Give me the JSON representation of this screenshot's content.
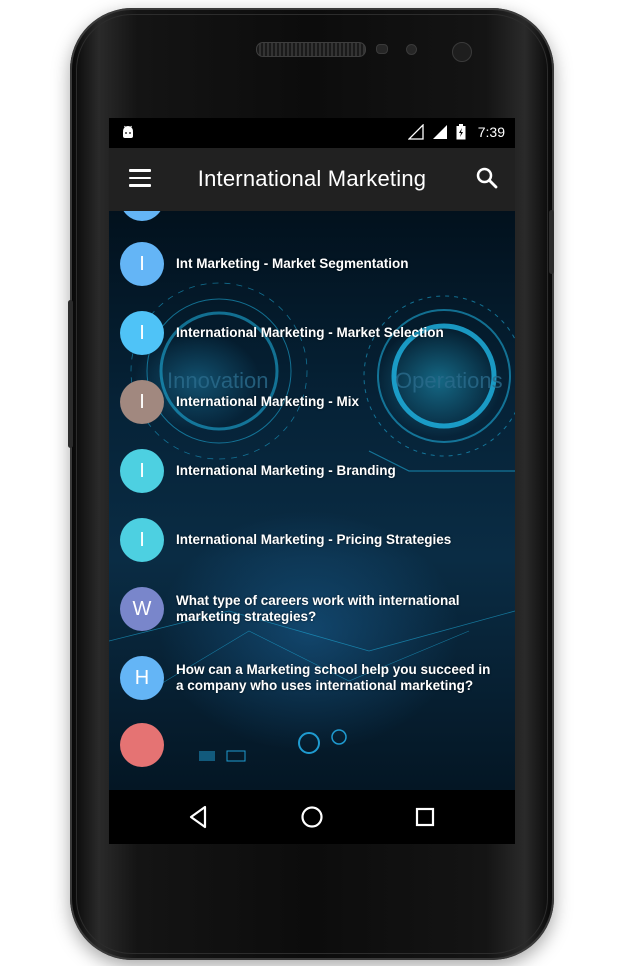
{
  "statusbar": {
    "time": "7:39"
  },
  "appbar": {
    "title": "International Marketing"
  },
  "list": {
    "items": [
      {
        "letter": "",
        "title": "",
        "color": "#64B5F6"
      },
      {
        "letter": "I",
        "title": "Int Marketing - Market Segmentation",
        "color": "#64B5F6"
      },
      {
        "letter": "I",
        "title": "International Marketing - Market Selection",
        "color": "#4FC3F7"
      },
      {
        "letter": "I",
        "title": "International Marketing - Mix",
        "color": "#A1887F"
      },
      {
        "letter": "I",
        "title": "International Marketing - Branding",
        "color": "#4DD0E1"
      },
      {
        "letter": "I",
        "title": "International Marketing - Pricing Strategies",
        "color": "#4DD0E1"
      },
      {
        "letter": "W",
        "title": "What type of careers work with international marketing strategies?",
        "color": "#7986CB"
      },
      {
        "letter": "H",
        "title": "How can a Marketing school help you succeed in a company who uses international marketing?",
        "color": "#64B5F6"
      },
      {
        "letter": "",
        "title": "",
        "color": "#E57373"
      }
    ]
  },
  "background_text": {
    "left": "Innovation",
    "right": "Operations"
  },
  "icons": {
    "menu": "hamburger-menu-icon",
    "search": "search-icon",
    "back": "nav-back-icon",
    "home": "nav-home-icon",
    "recents": "nav-recents-icon"
  }
}
